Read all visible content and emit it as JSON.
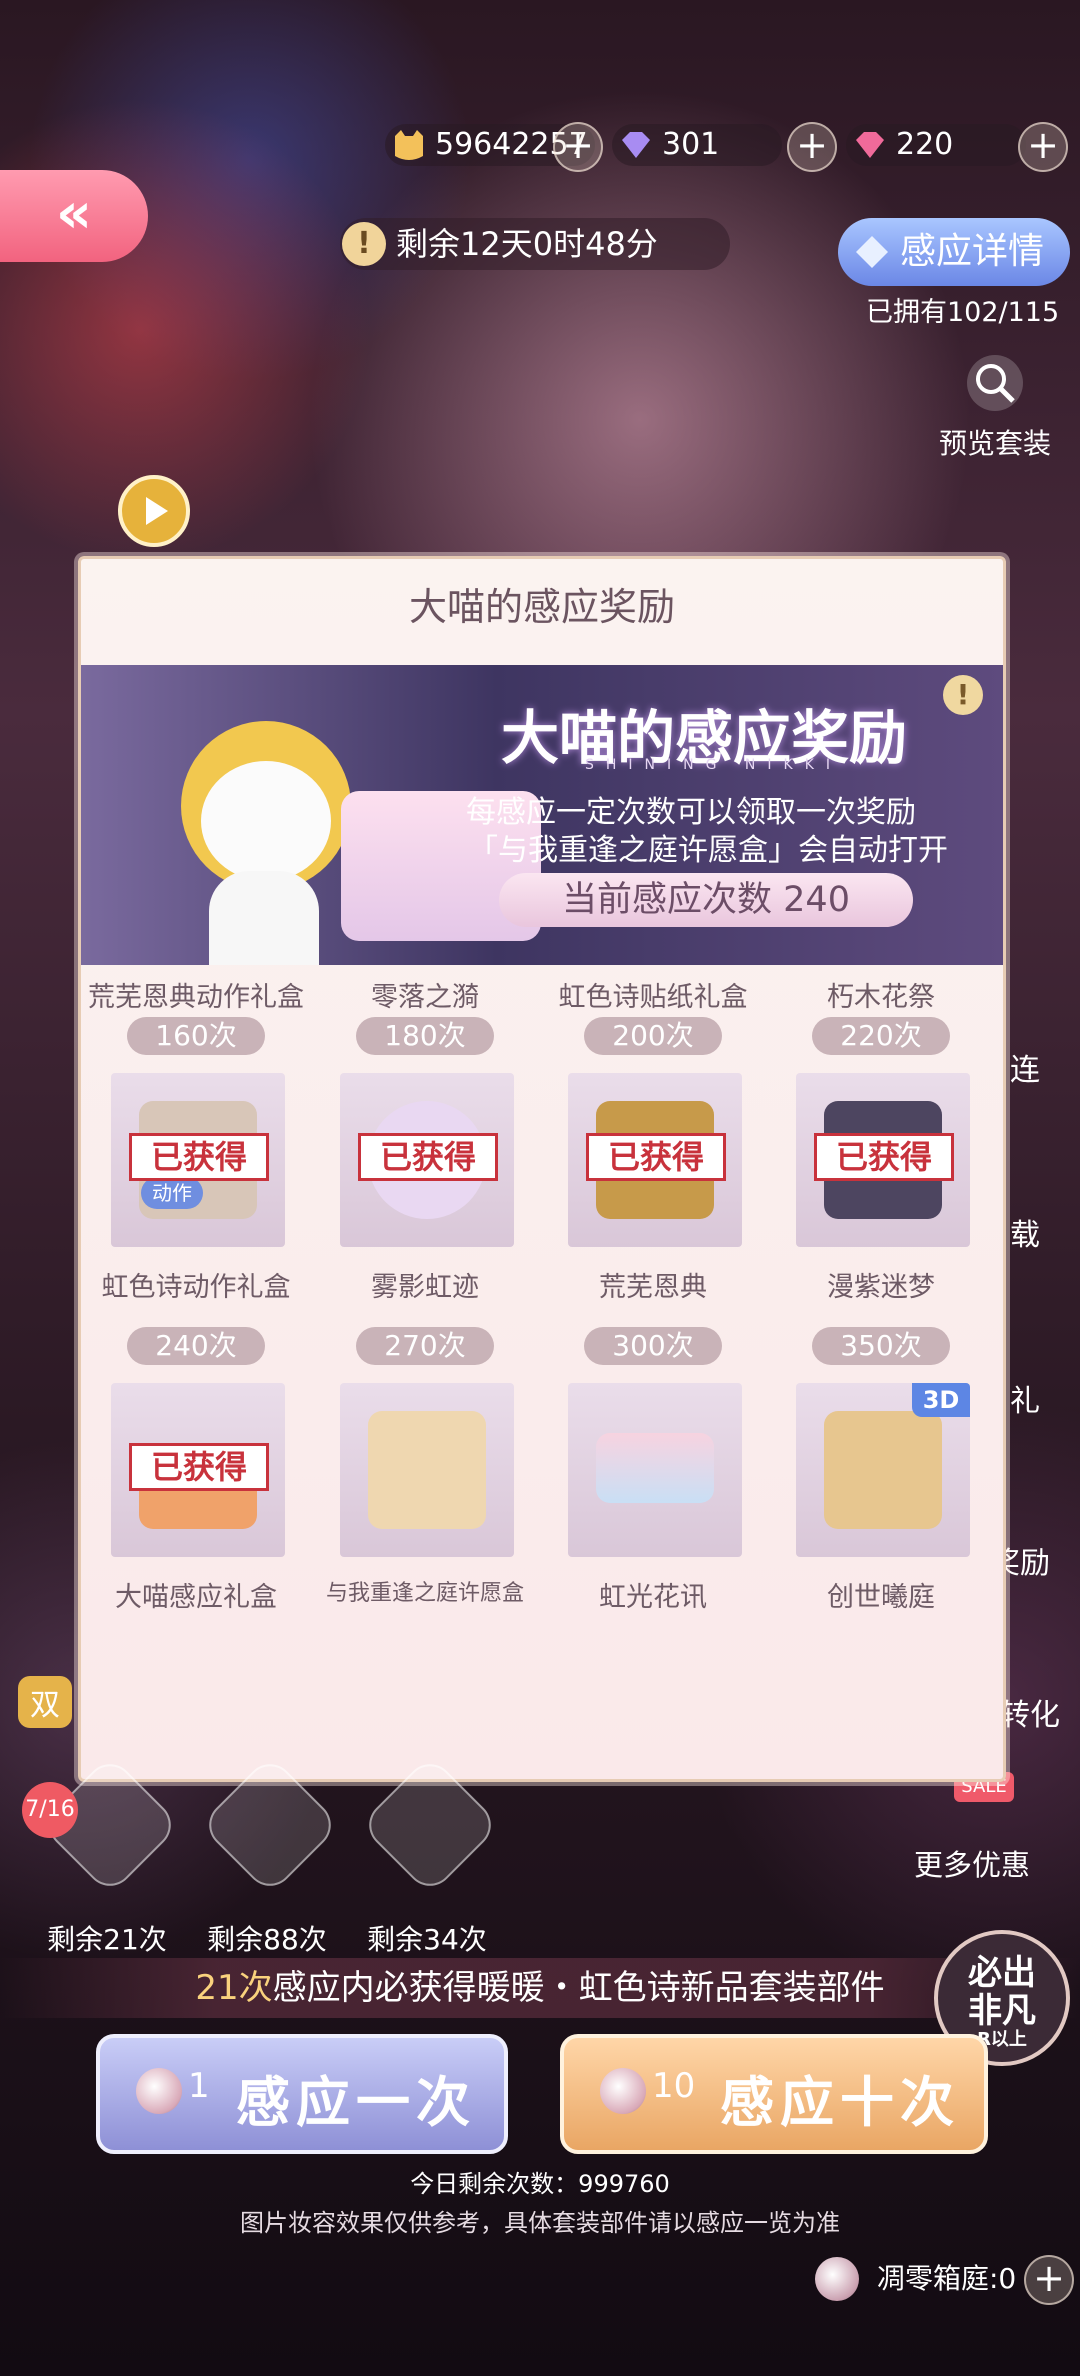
{
  "currencies": [
    {
      "icon": "gold-coin-icon",
      "value": "59642257"
    },
    {
      "icon": "purple-diamond-icon",
      "value": "301"
    },
    {
      "icon": "pink-diamond-icon",
      "value": "220"
    }
  ],
  "back_label": "«",
  "timer": {
    "text": "剩余12天0时48分"
  },
  "detail_button": {
    "label": "感应详情"
  },
  "owned_text": "已拥有102/115",
  "preview_label": "预览套装",
  "side_labels": [
    "连",
    "载",
    "礼",
    "奖励",
    "转化"
  ],
  "side_badge": "双",
  "more_offers": {
    "sale": "SALE",
    "label": "更多优惠"
  },
  "panel": {
    "title": "大喵的感应奖励",
    "banner": {
      "title": "大喵的感应奖励",
      "subtitle": "SHINING NIKKI",
      "desc1": "每感应一定次数可以领取一次奖励",
      "desc2": "「与我重逢之庭许愿盒」会自动打开",
      "count": "当前感应次数 240"
    },
    "top_names": [
      "荒芜恩典动作礼盒",
      "零落之漪",
      "虹色诗贴纸礼盒",
      "朽木花祭"
    ],
    "rewards": [
      {
        "count": "160次",
        "name": "虹色诗动作礼盒",
        "obtained": "已获得",
        "art_color": "#d8c6b8",
        "tag": "动作"
      },
      {
        "count": "180次",
        "name": "雾影虹迹",
        "obtained": "已获得",
        "art_color": "#e9d8f2",
        "tag": ""
      },
      {
        "count": "200次",
        "name": "荒芜恩典",
        "obtained": "已获得",
        "art_color": "#c79a4a",
        "tag": ""
      },
      {
        "count": "220次",
        "name": "漫紫迷梦",
        "obtained": "已获得",
        "art_color": "#4d4560",
        "tag": ""
      },
      {
        "count": "240次",
        "name": "大喵感应礼盒",
        "obtained": "已获得",
        "art_color": "#f0a26a",
        "tag": ""
      },
      {
        "count": "270次",
        "name": "与我重逢之庭许愿盒",
        "obtained": "",
        "art_color": "#efd7b0",
        "tag": ""
      },
      {
        "count": "300次",
        "name": "虹光花讯",
        "obtained": "",
        "art_color": "#d8d6f3",
        "tag": ""
      },
      {
        "count": "350次",
        "name": "创世曦庭",
        "obtained": "",
        "art_color": "#e7c68f",
        "tag": "3D"
      }
    ]
  },
  "featured": [
    {
      "label": "剩余21次"
    },
    {
      "label": "剩余88次"
    },
    {
      "label": "剩余34次"
    }
  ],
  "featured_badge": "7/16",
  "guarantee": {
    "prefix": "21次",
    "text": "感应内必获得暖暖・虹色诗新品套装部件"
  },
  "guarantee_badge": {
    "line1": "必出",
    "line2": "非凡",
    "line3": "R以上"
  },
  "single_button": {
    "cost": "1",
    "label": "感应一次"
  },
  "ten_button": {
    "cost": "10",
    "label": "感应十次"
  },
  "remaining_today": "今日剩余次数：999760",
  "disclaimer": "图片妆容效果仅供参考，具体套装部件请以感应一览为准",
  "withered": "凋零箱庭:0",
  "colors": {
    "accent_pink": "#f2637f",
    "obtained_red": "#c8323c",
    "badge_gray": "#c9b3b8"
  }
}
